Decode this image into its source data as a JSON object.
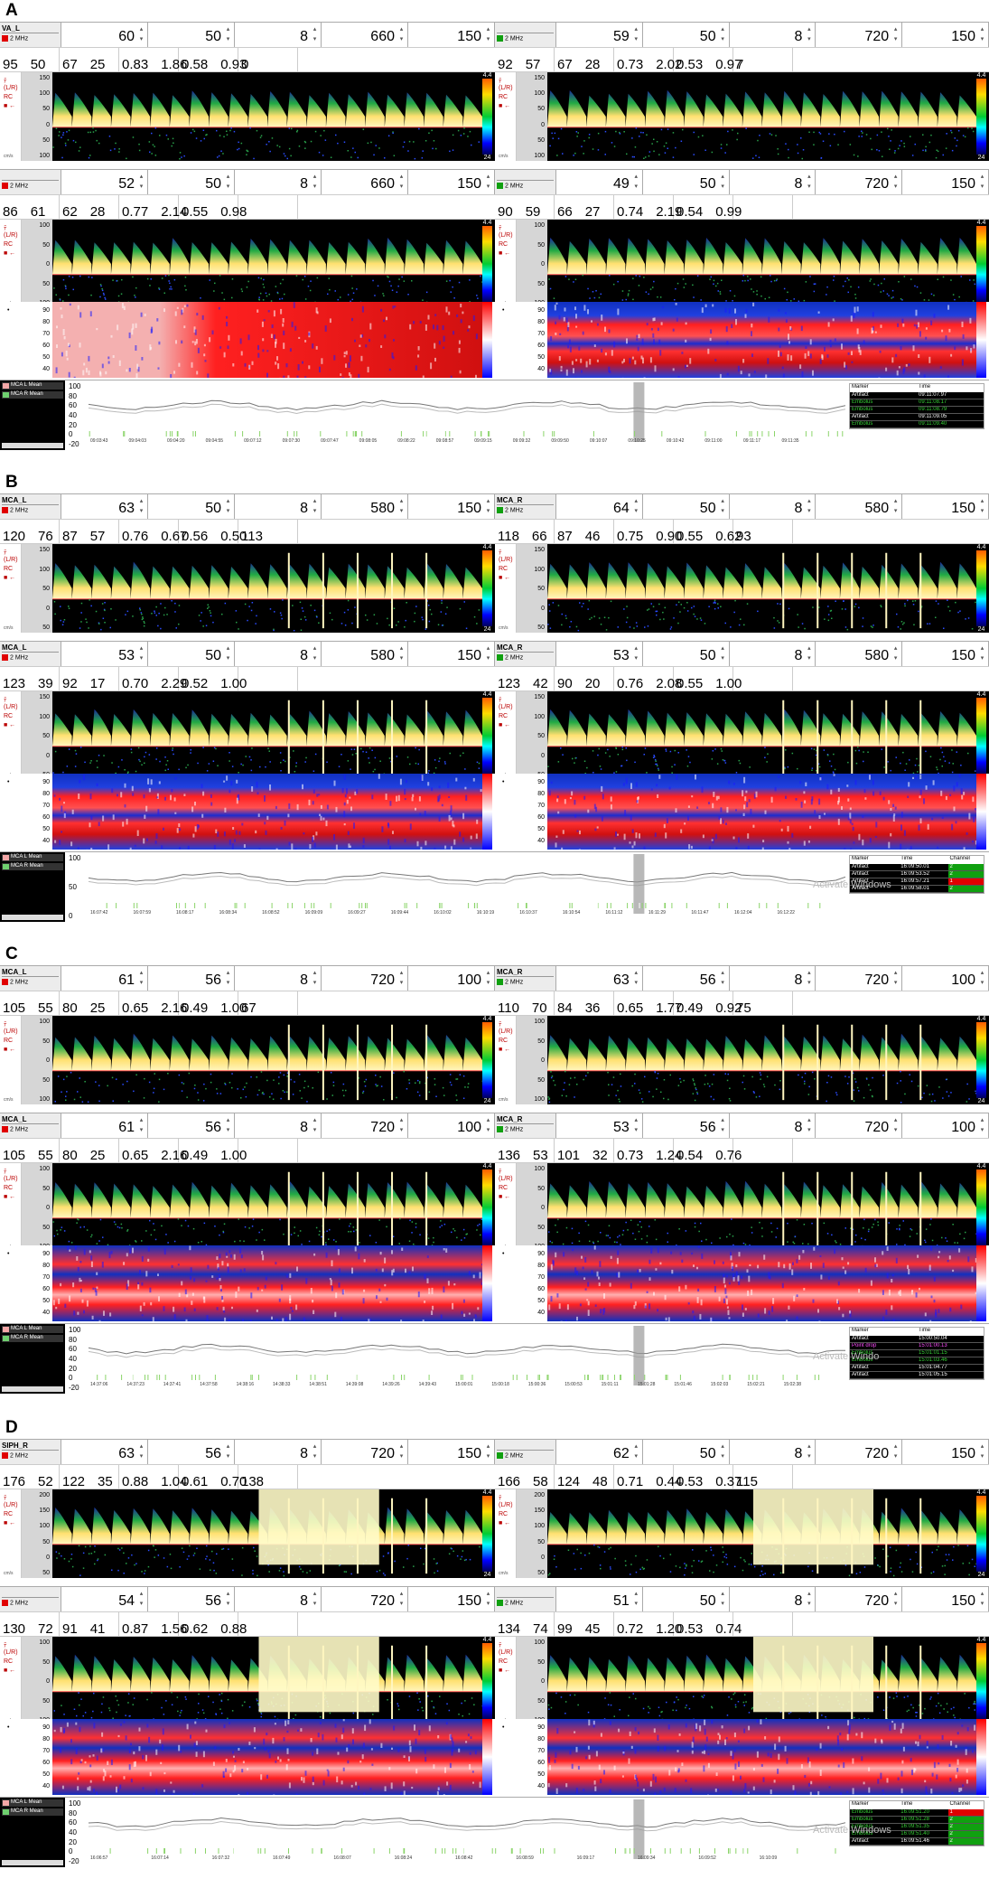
{
  "icons": {
    "arrows": "up-down-spinner",
    "marker": "arrow-left-icon"
  },
  "colors": {
    "left_tag": "#e00000",
    "right_tag": "#10a010",
    "legend_left": "#f4a7a7",
    "legend_right": "#6fd06f"
  },
  "common": {
    "freq": "2 MHz",
    "unit_label": "cm/s",
    "cbar_top": "4.4",
    "cbar_bottom": "24",
    "ruler_items": [
      "ﾃ",
      "(L/R)",
      "RC",
      "■ ←"
    ],
    "sv_small_label": "SV",
    "marker_hdr": "Marker",
    "time_hdr": "Time",
    "channel_hdr": "Channel"
  },
  "panels": [
    {
      "label": "A",
      "channels": [
        {
          "name": "VA_L",
          "vals": [
            "60",
            "50",
            "8",
            "660",
            "150"
          ],
          "meas": [
            [
              "95",
              "50"
            ],
            [
              "67",
              "25"
            ],
            [
              "0.83",
              "1.86"
            ],
            [
              "0.58",
              "0.93"
            ],
            [
              "0"
            ]
          ],
          "ticks": [
            "150",
            "100",
            "50",
            "0",
            "50",
            "100"
          ]
        },
        {
          "name": "",
          "vals": [
            "59",
            "50",
            "8",
            "720",
            "150"
          ],
          "meas": [
            [
              "92",
              "57"
            ],
            [
              "67",
              "28"
            ],
            [
              "0.73",
              "2.02"
            ],
            [
              "0.53",
              "0.97"
            ],
            [
              "7"
            ]
          ],
          "ticks": [
            "150",
            "100",
            "50",
            "0",
            "50",
            "100"
          ]
        },
        {
          "name": "",
          "vals": [
            "52",
            "50",
            "8",
            "660",
            "150"
          ],
          "meas": [
            [
              "86",
              "61"
            ],
            [
              "62",
              "28"
            ],
            [
              "0.77",
              "2.14"
            ],
            [
              "0.55",
              "0.98"
            ],
            [
              ""
            ]
          ],
          "ticks": [
            "100",
            "50",
            "0",
            "50",
            "100"
          ]
        },
        {
          "name": "",
          "vals": [
            "49",
            "50",
            "8",
            "720",
            "150"
          ],
          "meas": [
            [
              "90",
              "59"
            ],
            [
              "66",
              "27"
            ],
            [
              "0.74",
              "2.19"
            ],
            [
              "0.54",
              "0.99"
            ],
            [
              ""
            ]
          ],
          "ticks": [
            "100",
            "50",
            "0",
            "50",
            "100"
          ]
        }
      ],
      "trend_ticks": [
        "90",
        "80",
        "70",
        "60",
        "50",
        "40"
      ],
      "legend": [
        "MCA L Mean",
        "MCA R Mean"
      ],
      "yticks": [
        "100",
        "80",
        "60",
        "40",
        "20",
        "0",
        "-20"
      ],
      "times": [
        "09:03:43",
        "09:04:03",
        "09:04:20",
        "09:04:55",
        "09:07:12",
        "09:07:30",
        "09:07:47",
        "09:08:05",
        "09:08:22",
        "09:08:57",
        "09:09:15",
        "09:09:32",
        "09:09:50",
        "09:10:07",
        "09:10:25",
        "09:10:42",
        "09:11:00",
        "09:11:17",
        "09:11:35"
      ],
      "markers": [
        [
          "Artifact",
          "09:11:07.97"
        ],
        [
          "Embolus",
          "09:11:08.17"
        ],
        [
          "Embolus",
          "09:11:08.79"
        ],
        [
          "Artifact",
          "09:11:09.05"
        ],
        [
          "Embolus",
          "09:11:09.40"
        ]
      ],
      "mticks": [
        "100",
        "50",
        "0",
        "-50"
      ]
    },
    {
      "label": "B",
      "channels": [
        {
          "name": "MCA_L",
          "vals": [
            "63",
            "50",
            "8",
            "580",
            "150"
          ],
          "meas": [
            [
              "120",
              "76"
            ],
            [
              "87",
              "57"
            ],
            [
              "0.76",
              "0.67"
            ],
            [
              "0.56",
              "0.50"
            ],
            [
              "113"
            ]
          ],
          "ticks": [
            "150",
            "100",
            "50",
            "0",
            "50"
          ]
        },
        {
          "name": "MCA_R",
          "vals": [
            "64",
            "50",
            "8",
            "580",
            "150"
          ],
          "meas": [
            [
              "118",
              "66"
            ],
            [
              "87",
              "46"
            ],
            [
              "0.75",
              "0.90"
            ],
            [
              "0.55",
              "0.62"
            ],
            [
              "93"
            ]
          ],
          "ticks": [
            "150",
            "100",
            "50",
            "0",
            "50"
          ]
        },
        {
          "name": "MCA_L",
          "vals": [
            "53",
            "50",
            "8",
            "580",
            "150"
          ],
          "meas": [
            [
              "123",
              "39"
            ],
            [
              "92",
              "17"
            ],
            [
              "0.70",
              "2.29"
            ],
            [
              "0.52",
              "1.00"
            ],
            [
              ""
            ]
          ],
          "ticks": [
            "150",
            "100",
            "50",
            "0",
            "50"
          ]
        },
        {
          "name": "MCA_R",
          "vals": [
            "53",
            "50",
            "8",
            "580",
            "150"
          ],
          "meas": [
            [
              "123",
              "42"
            ],
            [
              "90",
              "20"
            ],
            [
              "0.76",
              "2.08"
            ],
            [
              "0.55",
              "1.00"
            ],
            [
              ""
            ]
          ],
          "ticks": [
            "150",
            "100",
            "50",
            "0",
            "50"
          ]
        }
      ],
      "trend_ticks": [
        "90",
        "80",
        "70",
        "60",
        "50",
        "40"
      ],
      "legend": [
        "MCA L Mean",
        "MCA R Mean"
      ],
      "yticks": [
        "100",
        "50",
        "0"
      ],
      "times": [
        "16:07:42",
        "16:07:59",
        "16:08:17",
        "16:08:34",
        "16:08:52",
        "16:09:09",
        "16:09:27",
        "16:09:44",
        "16:10:02",
        "16:10:19",
        "16:10:37",
        "16:10:54",
        "16:11:12",
        "16:11:29",
        "16:11:47",
        "16:12:04",
        "16:12:22"
      ],
      "markers": [
        [
          "Artifact",
          "16:09:50.01",
          "2"
        ],
        [
          "Artifact",
          "16:09:53.52",
          "2"
        ],
        [
          "Artifact",
          "16:09:57.21",
          "1"
        ],
        [
          "Artifact",
          "16:09:58.01",
          "2"
        ]
      ],
      "mticks": [
        "100",
        "50",
        "0",
        "-50"
      ],
      "watermark": "Activate Windows"
    },
    {
      "label": "C",
      "channels": [
        {
          "name": "MCA_L",
          "vals": [
            "61",
            "56",
            "8",
            "720",
            "100"
          ],
          "meas": [
            [
              "105",
              "55"
            ],
            [
              "80",
              "25"
            ],
            [
              "0.65",
              "2.16"
            ],
            [
              "0.49",
              "1.00"
            ],
            [
              "67"
            ]
          ],
          "ticks": [
            "100",
            "50",
            "0",
            "50",
            "100"
          ]
        },
        {
          "name": "MCA_R",
          "vals": [
            "63",
            "56",
            "8",
            "720",
            "100"
          ],
          "meas": [
            [
              "110",
              "70"
            ],
            [
              "84",
              "36"
            ],
            [
              "0.65",
              "1.77"
            ],
            [
              "0.49",
              "0.92"
            ],
            [
              "75"
            ]
          ],
          "ticks": [
            "100",
            "50",
            "0",
            "50",
            "100"
          ]
        },
        {
          "name": "MCA_L",
          "vals": [
            "61",
            "56",
            "8",
            "720",
            "100"
          ],
          "meas": [
            [
              "105",
              "55"
            ],
            [
              "80",
              "25"
            ],
            [
              "0.65",
              "2.16"
            ],
            [
              "0.49",
              "1.00"
            ],
            [
              ""
            ]
          ],
          "ticks": [
            "100",
            "50",
            "0",
            "50",
            "100"
          ]
        },
        {
          "name": "MCA_R",
          "vals": [
            "53",
            "56",
            "8",
            "720",
            "100"
          ],
          "meas": [
            [
              "136",
              "53"
            ],
            [
              "101",
              "32"
            ],
            [
              "0.73",
              "1.24"
            ],
            [
              "0.54",
              "0.76"
            ],
            [
              ""
            ]
          ],
          "ticks": [
            "100",
            "50",
            "0",
            "50",
            "100"
          ]
        }
      ],
      "trend_ticks": [
        "90",
        "80",
        "70",
        "60",
        "50",
        "40"
      ],
      "legend": [
        "MCA L Mean",
        "MCA R Mean"
      ],
      "yticks": [
        "100",
        "80",
        "60",
        "40",
        "20",
        "0",
        "-20"
      ],
      "times": [
        "14:37:06",
        "14:37:23",
        "14:37:41",
        "14:37:58",
        "14:38:16",
        "14:38:33",
        "14:38:51",
        "14:39:08",
        "14:39:26",
        "14:39:43",
        "15:00:01",
        "15:00:18",
        "15:00:36",
        "15:00:53",
        "15:01:11",
        "15:01:28",
        "15:01:46",
        "15:02:03",
        "15:02:21",
        "15:02:38"
      ],
      "markers": [
        [
          "Artifact",
          "15:00:50.04"
        ],
        [
          "Point drop",
          "15:01:00.13"
        ],
        [
          "Embolus",
          "15:01:01.15"
        ],
        [
          "Embolus",
          "15:01:03.46"
        ],
        [
          "Artifact",
          "15:01:04.77"
        ],
        [
          "Artifact",
          "15:01:05.15"
        ]
      ],
      "mticks": [],
      "watermark": "Activate Windo"
    },
    {
      "label": "D",
      "channels": [
        {
          "name": "SIPH_R",
          "vals": [
            "63",
            "56",
            "8",
            "720",
            "150"
          ],
          "meas": [
            [
              "176",
              "52"
            ],
            [
              "122",
              "35"
            ],
            [
              "0.88",
              "1.04"
            ],
            [
              "0.61",
              "0.70"
            ],
            [
              "138"
            ]
          ],
          "ticks": [
            "200",
            "150",
            "100",
            "50",
            "0",
            "50"
          ]
        },
        {
          "name": "",
          "vals": [
            "62",
            "50",
            "8",
            "720",
            "150"
          ],
          "meas": [
            [
              "166",
              "58"
            ],
            [
              "124",
              "48"
            ],
            [
              "0.71",
              "0.44"
            ],
            [
              "0.53",
              "0.37"
            ],
            [
              "115"
            ]
          ],
          "ticks": [
            "200",
            "150",
            "100",
            "50",
            "0",
            "50"
          ]
        },
        {
          "name": "",
          "vals": [
            "54",
            "56",
            "8",
            "720",
            "150"
          ],
          "meas": [
            [
              "130",
              "72"
            ],
            [
              "91",
              "41"
            ],
            [
              "0.87",
              "1.56"
            ],
            [
              "0.62",
              "0.88"
            ],
            [
              ""
            ]
          ],
          "ticks": [
            "100",
            "50",
            "0",
            "50",
            "100"
          ]
        },
        {
          "name": "",
          "vals": [
            "51",
            "50",
            "8",
            "720",
            "150"
          ],
          "meas": [
            [
              "134",
              "74"
            ],
            [
              "99",
              "45"
            ],
            [
              "0.72",
              "1.20"
            ],
            [
              "0.53",
              "0.74"
            ],
            [
              ""
            ]
          ],
          "ticks": [
            "100",
            "50",
            "0",
            "50",
            "100"
          ]
        }
      ],
      "trend_ticks": [
        "90",
        "80",
        "70",
        "60",
        "50",
        "40"
      ],
      "legend": [
        "MCA L Mean",
        "MCA R Mean"
      ],
      "yticks": [
        "100",
        "80",
        "60",
        "40",
        "20",
        "0",
        "-20"
      ],
      "times": [
        "16:06:57",
        "16:07:14",
        "16:07:32",
        "16:07:49",
        "16:08:07",
        "16:08:24",
        "16:08:42",
        "16:08:59",
        "16:09:17",
        "16:09:34",
        "16:09:52",
        "16:10:09"
      ],
      "markers": [
        [
          "Embolus",
          "16:09:51.20",
          "1"
        ],
        [
          "Embolus",
          "16:09:51.28",
          "2"
        ],
        [
          "Embolus",
          "16:09:51.35",
          "2"
        ],
        [
          "Embolus",
          "16:09:51.40",
          "2"
        ],
        [
          "Artifact",
          "16:09:51.46",
          "2"
        ]
      ],
      "mticks": [
        "100",
        "50",
        "0"
      ],
      "watermark": "Activate Windows"
    }
  ]
}
